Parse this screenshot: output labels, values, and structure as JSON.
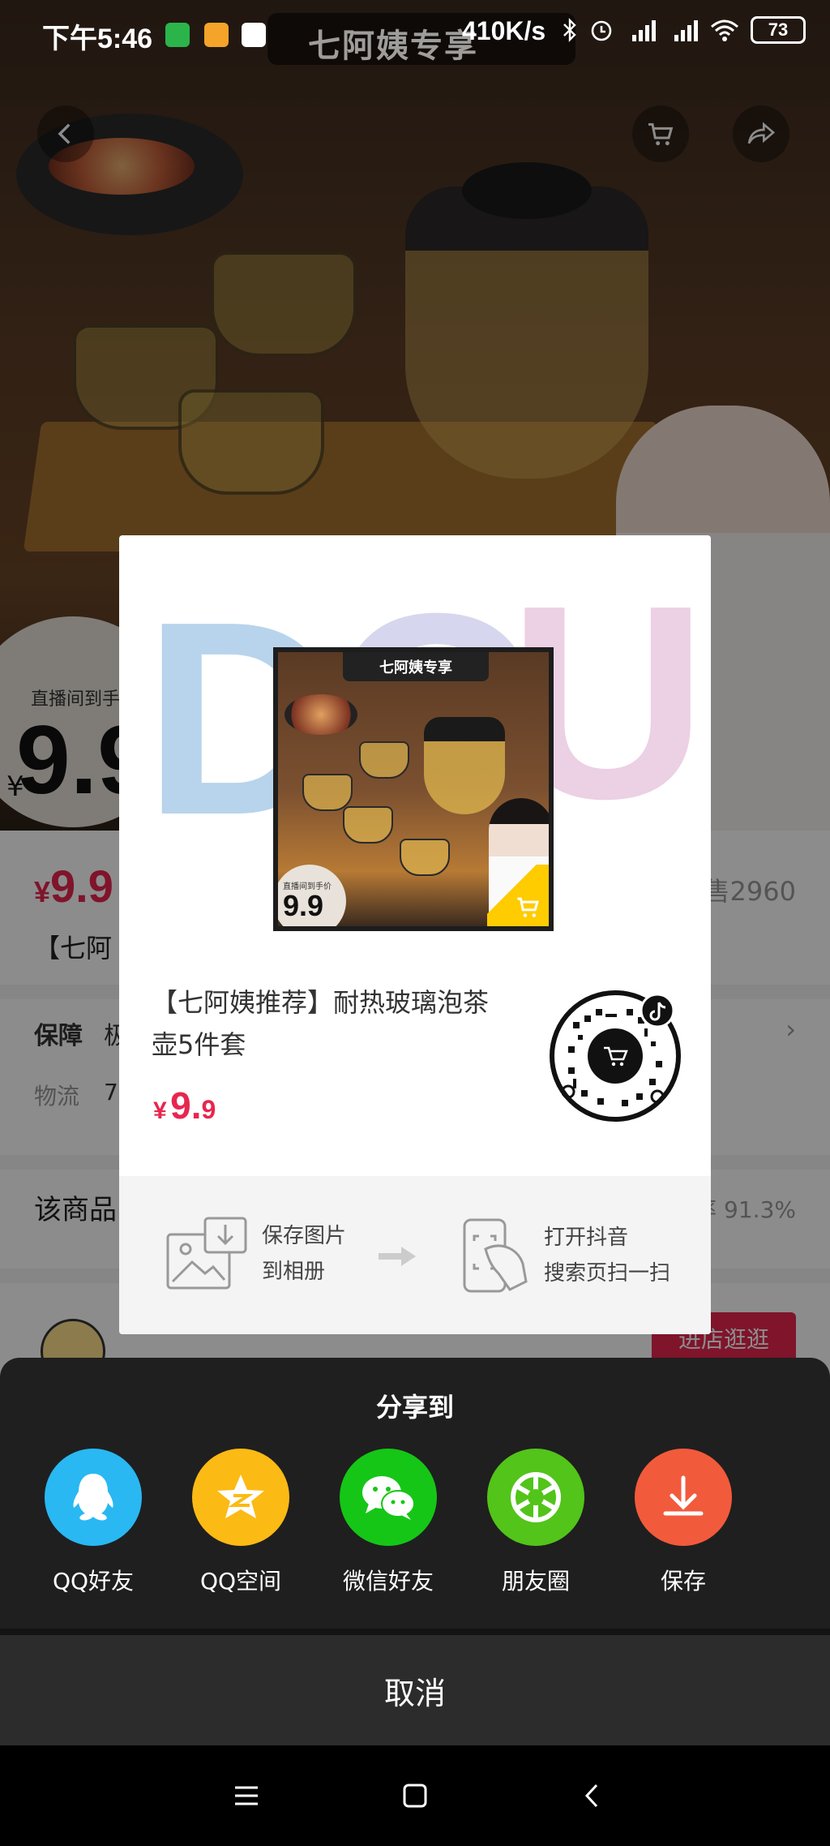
{
  "status_bar": {
    "time": "下午5:46",
    "network_speed": "410K/s",
    "battery": "73",
    "page_title": "七阿姨专享"
  },
  "product_page": {
    "hero_badge_label": "直播间到手",
    "hero_badge_price": "9.9",
    "hero_yen": "¥",
    "price_yen": "¥",
    "price": "9.9",
    "sales_fragment": "售2960",
    "title_fragment": "【七阿",
    "guarantee_label": "保障",
    "guarantee_value": "极",
    "logistics_label": "物流",
    "logistics_value": "7",
    "rating_label": "该商品",
    "rating_value": "率 91.3%",
    "shop_button": "进店逛逛"
  },
  "poster": {
    "brand_letters": [
      "D",
      "O",
      "U"
    ],
    "image_tag": "七阿姨专享",
    "image_badge_label": "直播间到手价",
    "image_badge_price": "9.9",
    "product_title": "【七阿姨推荐】耐热玻璃泡茶壶5件套",
    "price_yen": "¥",
    "price_int": "9.",
    "price_dec": "9",
    "step1_line1": "保存图片",
    "step1_line2": "到相册",
    "step2_line1": "打开抖音",
    "step2_line2": "搜索页扫一扫"
  },
  "share_sheet": {
    "title": "分享到",
    "items": [
      {
        "label": "QQ好友",
        "icon": "qq-icon",
        "color": "#29b8f2"
      },
      {
        "label": "QQ空间",
        "icon": "qzone-icon",
        "color": "#fcba14"
      },
      {
        "label": "微信好友",
        "icon": "wechat-icon",
        "color": "#15c617"
      },
      {
        "label": "朋友圈",
        "icon": "moments-icon",
        "color": "#52c41a"
      },
      {
        "label": "保存",
        "icon": "download-icon",
        "color": "#f25a3c"
      }
    ],
    "cancel": "取消"
  },
  "colors": {
    "accent_red": "#e8264f",
    "sheet_bg": "#1f1f1f"
  }
}
